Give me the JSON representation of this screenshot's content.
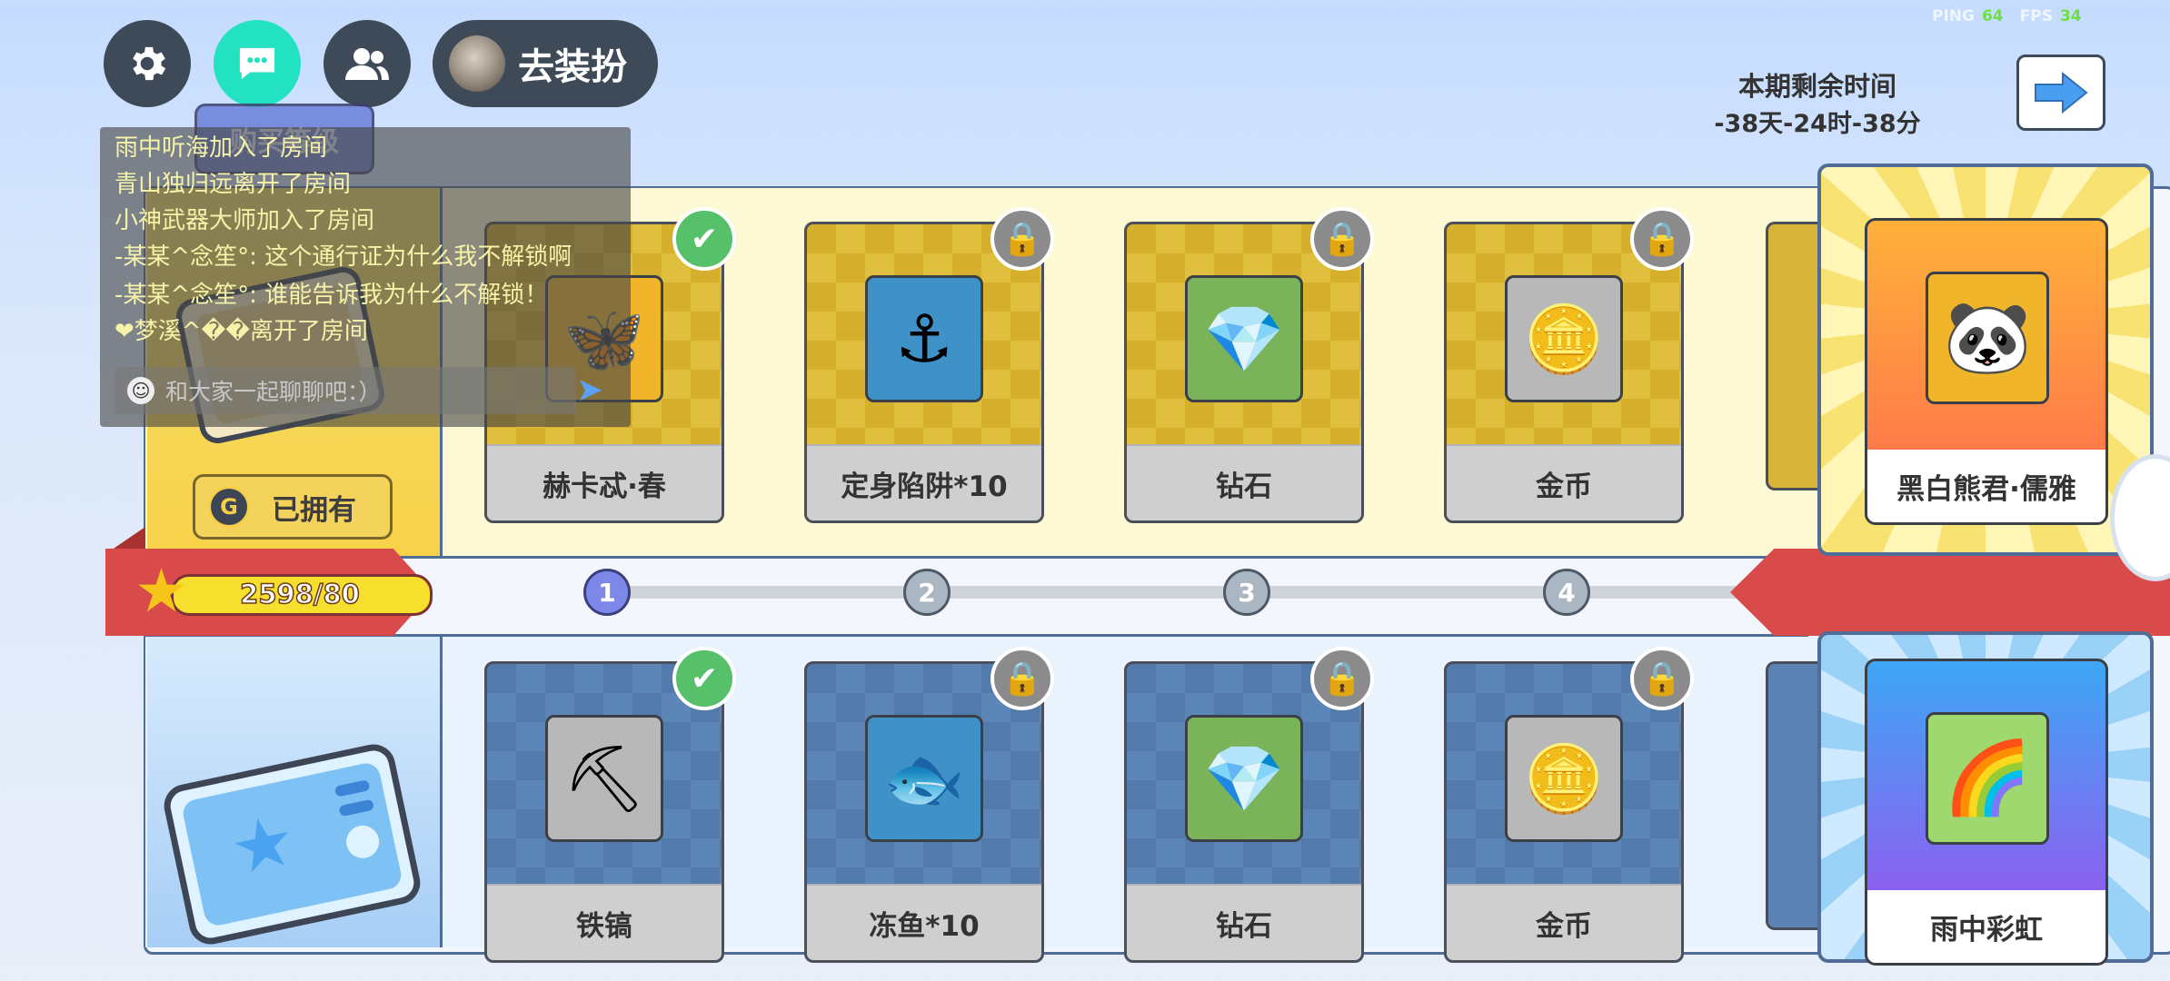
{
  "hud": {
    "dress_label": "去装扮",
    "ping_label": "PING",
    "ping_value": "64",
    "fps_label": "FPS",
    "fps_value": "34"
  },
  "season": {
    "title": "本期剩余时间",
    "remaining": "-38天-24时-38分"
  },
  "left": {
    "owned_label": "已拥有",
    "g_glyph": "G",
    "buy_label": "购买等级"
  },
  "progress": {
    "xp_text": "2598/80",
    "levels": [
      "1",
      "2",
      "3",
      "4"
    ],
    "current_level": 1
  },
  "rewards_top": [
    {
      "label": "赫卡忒·春",
      "status": "claimed",
      "icon": "wings-icon"
    },
    {
      "label": "定身陷阱*10",
      "status": "locked",
      "icon": "anchor-trap-icon"
    },
    {
      "label": "钻石",
      "status": "locked",
      "icon": "diamond-icon"
    },
    {
      "label": "金币",
      "status": "locked",
      "icon": "coin-icon"
    }
  ],
  "rewards_bottom": [
    {
      "label": "铁镐",
      "status": "claimed",
      "icon": "pickaxe-icon"
    },
    {
      "label": "冻鱼*10",
      "status": "locked",
      "icon": "frozen-fish-icon"
    },
    {
      "label": "钻石",
      "status": "locked",
      "icon": "diamond-icon"
    },
    {
      "label": "金币",
      "status": "locked",
      "icon": "coin-icon"
    }
  ],
  "premium": {
    "top_label": "黑白熊君·儒雅",
    "top_icon": "panda-icon",
    "bottom_label": "雨中彩虹",
    "bottom_icon": "rainbow-icon"
  },
  "chat": {
    "lines": [
      "雨中听海加入了房间",
      "青山独归远离开了房间",
      "小神武器大师加入了房间",
      "-某某^念笙°: 这个通行证为什么我不解锁啊",
      "-某某^念笙°: 谁能告诉我为什么不解锁！",
      "❤梦溪^��离开了房间"
    ],
    "placeholder": "和大家一起聊聊吧：）"
  },
  "colors": {
    "accent_teal": "#23e2c2",
    "ribbon_red": "#d94b4b",
    "xp_yellow": "#f7df2e",
    "ping_green": "#6fe042"
  }
}
